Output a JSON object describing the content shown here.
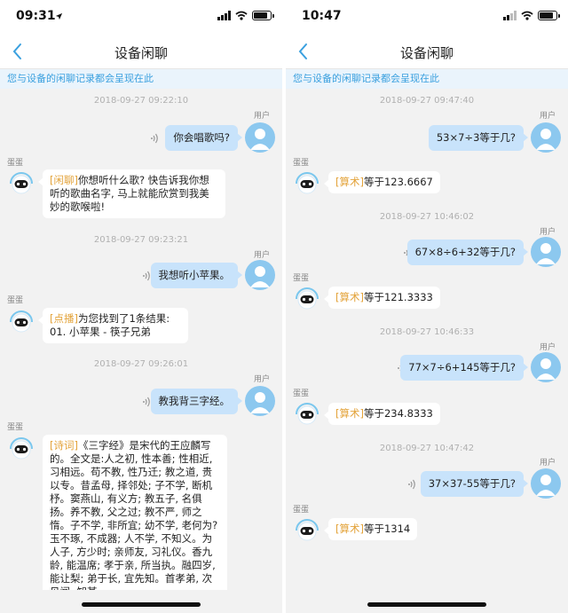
{
  "left": {
    "time": "09:31",
    "nav_title": "设备闲聊",
    "notice": "您与设备的闲聊记录都会呈现在此",
    "user_label": "用户",
    "bot_label": "蛋蛋",
    "messages": [
      {
        "timestamp": "2018-09-27 09:22:10",
        "user_text": "你会唱歌吗?",
        "bot_tag": "[闲聊]",
        "bot_text": "你想听什么歌? 快告诉我你想听的歌曲名字, 马上就能欣赏到我美妙的歌喉啦!"
      },
      {
        "timestamp": "2018-09-27 09:23:21",
        "user_text": "我想听小苹果。",
        "bot_tag": "[点播]",
        "bot_text": "为您找到了1条结果:\n01. 小苹果 - 筷子兄弟"
      },
      {
        "timestamp": "2018-09-27 09:26:01",
        "user_text": "教我背三字经。",
        "bot_tag": "[诗词]",
        "bot_text": "《三字经》是宋代的王应麟写的。全文是:人之初, 性本善; 性相近, 习相远。苟不教, 性乃迁; 教之道, 贵以专。昔孟母, 择邻处; 子不学, 断机杼。窦燕山, 有义方; 教五子, 名俱扬。养不教, 父之过; 教不严, 师之惰。子不学, 非所宜; 幼不学, 老何为? 玉不琢, 不成器; 人不学, 不知义。为人子, 方少时; 亲师友, 习礼仪。香九龄, 能温席; 孝于亲, 所当执。融四岁, 能让梨; 弟于长, 宜先知。首孝弟, 次见闻; 知某"
      }
    ]
  },
  "right": {
    "time": "10:47",
    "nav_title": "设备闲聊",
    "notice": "您与设备的闲聊记录都会呈现在此",
    "user_label": "用户",
    "bot_label": "蛋蛋",
    "messages": [
      {
        "timestamp": "2018-09-27 09:47:40",
        "user_text": "53×7÷3等于几?",
        "bot_tag": "[算术]",
        "bot_text": "等于123.6667"
      },
      {
        "timestamp": "2018-09-27 10:46:02",
        "user_text": "67×8÷6+32等于几?",
        "bot_tag": "[算术]",
        "bot_text": "等于121.3333"
      },
      {
        "timestamp": "2018-09-27 10:46:33",
        "user_text": "77×7÷6+145等于几?",
        "bot_tag": "[算术]",
        "bot_text": "等于234.8333"
      },
      {
        "timestamp": "2018-09-27 10:47:42",
        "user_text": "37×37-55等于几?",
        "bot_tag": "[算术]",
        "bot_text": "等于1314"
      }
    ]
  },
  "icons": {
    "back": "chevron-left-icon",
    "signal": "signal-bars-icon",
    "wifi": "wifi-icon",
    "battery": "battery-icon",
    "location": "location-arrow-icon",
    "voice": "voice-wave-icon",
    "user_avatar": "user-avatar-icon",
    "bot_avatar": "robot-avatar-icon"
  },
  "colors": {
    "accent": "#3aa0df",
    "user_bubble": "#c8e3fb",
    "tag": "#e3a33a",
    "background": "#f2f2f2"
  }
}
